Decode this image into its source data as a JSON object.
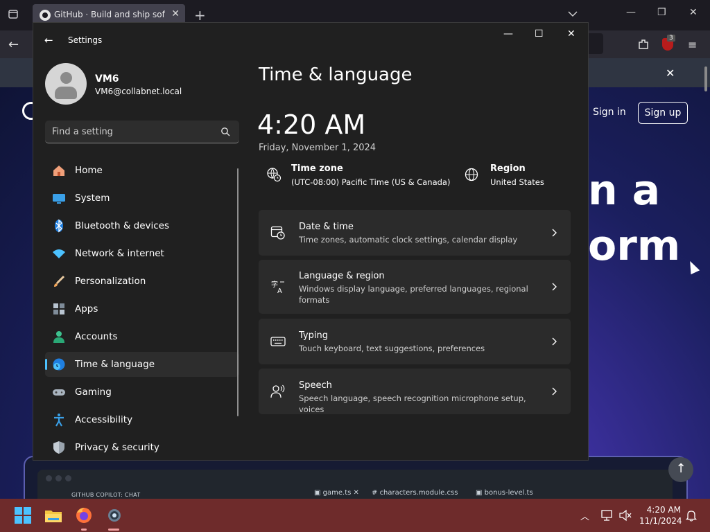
{
  "browser": {
    "tab_title": "GitHub · Build and ship software",
    "new_tab": "+",
    "close": "✕",
    "back": "←",
    "menu": "≡",
    "ublock_count": "3",
    "notification_close": "✕"
  },
  "github_page": {
    "sign_in": "Sign in",
    "sign_up": "Sign up",
    "hero_line_1": "n a",
    "hero_line_2": "orm",
    "editor_panel_label": "GITHUB COPILOT: CHAT",
    "editor_tabs": [
      "game.ts",
      "characters.module.css",
      "bonus-level.ts"
    ],
    "scroll_top": "↑"
  },
  "settings": {
    "title": "Settings",
    "back": "←",
    "minimize": "—",
    "maximize": "☐",
    "close": "✕",
    "user": {
      "name": "VM6",
      "email": "VM6@collabnet.local"
    },
    "search_placeholder": "Find a setting",
    "nav": [
      {
        "label": "Home",
        "icon": "home-icon"
      },
      {
        "label": "System",
        "icon": "system-icon"
      },
      {
        "label": "Bluetooth & devices",
        "icon": "bluetooth-icon"
      },
      {
        "label": "Network & internet",
        "icon": "network-icon"
      },
      {
        "label": "Personalization",
        "icon": "brush-icon"
      },
      {
        "label": "Apps",
        "icon": "apps-icon"
      },
      {
        "label": "Accounts",
        "icon": "accounts-icon"
      },
      {
        "label": "Time & language",
        "icon": "time-language-icon",
        "active": true
      },
      {
        "label": "Gaming",
        "icon": "gamepad-icon"
      },
      {
        "label": "Accessibility",
        "icon": "accessibility-icon"
      },
      {
        "label": "Privacy & security",
        "icon": "shield-icon"
      }
    ],
    "page_title": "Time & language",
    "clock": {
      "time": "4:20 AM",
      "date": "Friday, November 1, 2024"
    },
    "time_zone": {
      "title": "Time zone",
      "value": "(UTC-08:00) Pacific Time (US & Canada)"
    },
    "region": {
      "title": "Region",
      "value": "United States"
    },
    "cards": [
      {
        "title": "Date & time",
        "subtitle": "Time zones, automatic clock settings, calendar display",
        "icon": "calendar-clock-icon"
      },
      {
        "title": "Language & region",
        "subtitle": "Windows display language, preferred languages, regional formats",
        "icon": "language-icon"
      },
      {
        "title": "Typing",
        "subtitle": "Touch keyboard, text suggestions, preferences",
        "icon": "keyboard-icon"
      },
      {
        "title": "Speech",
        "subtitle": "Speech language, speech recognition microphone setup, voices",
        "icon": "speech-icon"
      }
    ]
  },
  "taskbar": {
    "apps": [
      "start-icon",
      "file-explorer-icon",
      "firefox-icon",
      "settings-icon"
    ],
    "time": "4:20 AM",
    "date": "11/1/2024",
    "tray_chevron": "^"
  },
  "colors": {
    "accent": "#4cc2ff",
    "taskbar": "#6e2b2b",
    "settings_bg": "#202020",
    "card_bg": "#2b2b2b"
  }
}
